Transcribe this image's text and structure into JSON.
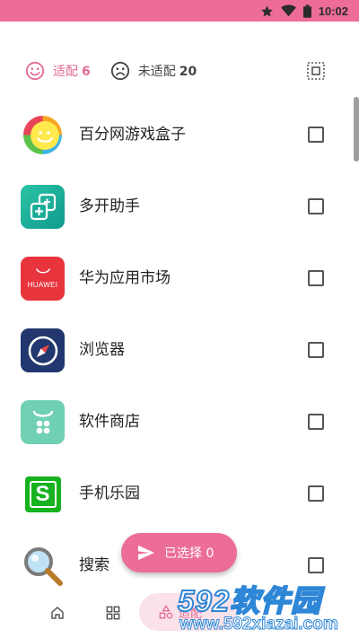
{
  "status_bar": {
    "time": "10:02",
    "icons": [
      "star-icon",
      "wifi-icon",
      "battery-icon"
    ],
    "color": "#ee6d96"
  },
  "tabs": {
    "adapted": {
      "label": "适配",
      "count": "6"
    },
    "not_adapted": {
      "label": "未适配",
      "count": "20"
    },
    "accent_color": "#e26b95"
  },
  "apps": [
    {
      "name": "百分网游戏盒子",
      "icon": "baifen-game-box-icon",
      "checked": false
    },
    {
      "name": "多开助手",
      "icon": "multi-open-assistant-icon",
      "checked": false
    },
    {
      "name": "华为应用市场",
      "icon": "huawei-appgallery-icon",
      "icon_text": "HUAWEI",
      "checked": false
    },
    {
      "name": "浏览器",
      "icon": "browser-compass-icon",
      "checked": false
    },
    {
      "name": "软件商店",
      "icon": "software-store-icon",
      "checked": false
    },
    {
      "name": "手机乐园",
      "icon": "phone-paradise-icon",
      "icon_text": "S",
      "checked": false
    },
    {
      "name": "搜索",
      "icon": "magnifier-search-icon",
      "checked": false
    }
  ],
  "fab": {
    "label": "已选择 0",
    "icon": "send-icon"
  },
  "bottom_nav": {
    "items": [
      {
        "name": "home-icon"
      },
      {
        "name": "grid-icon"
      },
      {
        "name": "shapes-icon",
        "label": "适配"
      }
    ]
  },
  "watermark": {
    "big": "592软件园",
    "small": "www.592xiazai.com"
  }
}
